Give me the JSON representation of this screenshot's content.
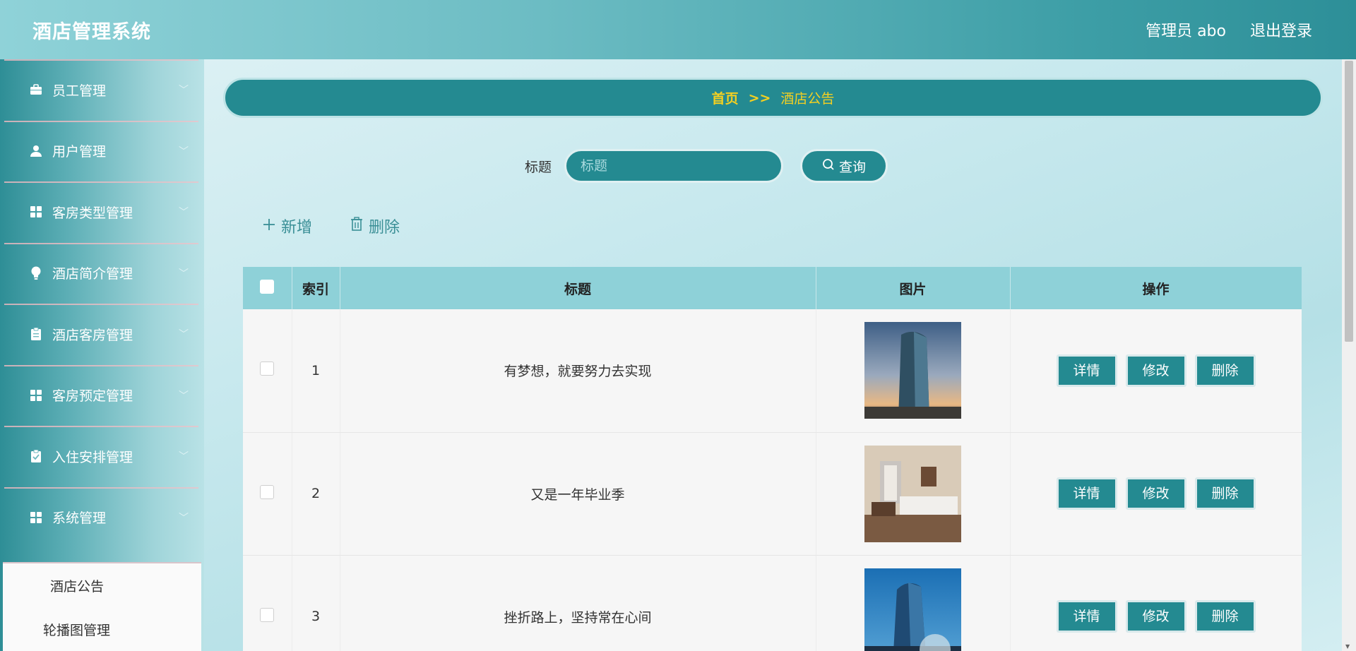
{
  "header": {
    "title": "酒店管理系统",
    "admin_label": "管理员 abo",
    "logout_label": "退出登录"
  },
  "sidebar": {
    "items": [
      {
        "label": "员工管理",
        "icon": "briefcase-icon"
      },
      {
        "label": "用户管理",
        "icon": "user-icon"
      },
      {
        "label": "客房类型管理",
        "icon": "grid-icon"
      },
      {
        "label": "酒店简介管理",
        "icon": "lightbulb-icon"
      },
      {
        "label": "酒店客房管理",
        "icon": "clipboard-icon"
      },
      {
        "label": "客房预定管理",
        "icon": "grid-icon"
      },
      {
        "label": "入住安排管理",
        "icon": "clipboard-check-icon"
      },
      {
        "label": "系统管理",
        "icon": "grid-icon"
      }
    ],
    "submenu": [
      "酒店公告",
      "轮播图管理"
    ]
  },
  "breadcrumb": {
    "home": "首页",
    "separator": ">>",
    "current": "酒店公告"
  },
  "search": {
    "label": "标题",
    "placeholder": "标题",
    "button_label": "查询"
  },
  "actions": {
    "add_label": "新增",
    "delete_label": "删除"
  },
  "table": {
    "headers": [
      "",
      "索引",
      "标题",
      "图片",
      "操作"
    ],
    "rows": [
      {
        "index": "1",
        "title": "有梦想，就要努力去实现",
        "image": "hotel-tower-photo"
      },
      {
        "index": "2",
        "title": "又是一年毕业季",
        "image": "hotel-room-photo"
      },
      {
        "index": "3",
        "title": "挫折路上，坚持常在心间",
        "image": "hotel-night-photo"
      }
    ],
    "row_buttons": {
      "detail": "详情",
      "edit": "修改",
      "delete": "删除"
    }
  },
  "colors": {
    "primary": "#248a91",
    "accent": "#f5d020",
    "table_header": "#8ed1d8"
  }
}
